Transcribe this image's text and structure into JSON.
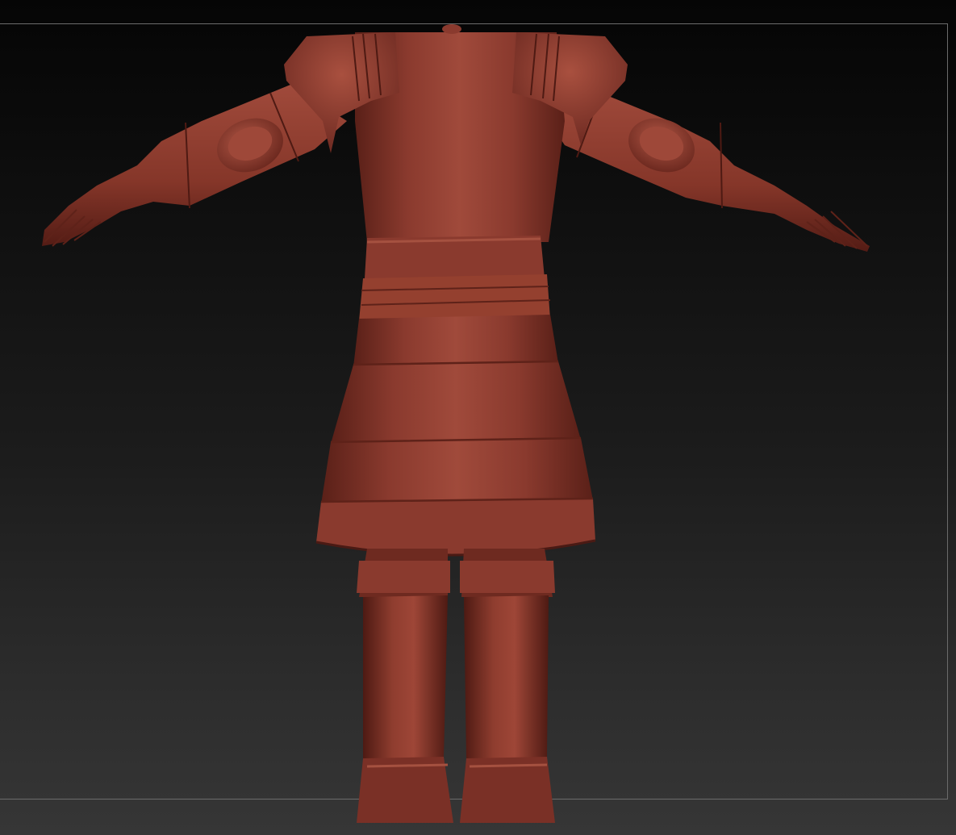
{
  "app": {
    "viewport_background": {
      "top": "#050505",
      "bottom": "#363636"
    },
    "frame_color": "#6b6b6b",
    "material": {
      "base": "#8a3a2e",
      "highlight": "#b35a48",
      "shadow": "#4a1a14",
      "edge": "#5e2219"
    }
  }
}
